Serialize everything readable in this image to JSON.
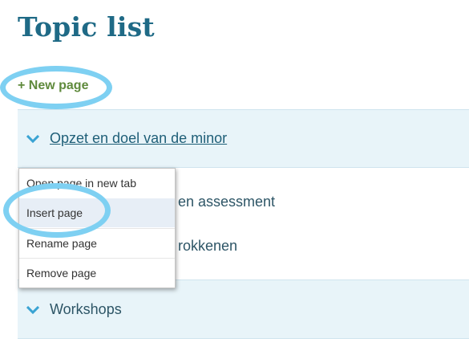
{
  "page": {
    "title": "Topic list"
  },
  "actions": {
    "new_page": "+ New page"
  },
  "topics": [
    {
      "label": "Opzet en doel van de minor"
    },
    {
      "label_partial_1": "en assessment",
      "label_partial_2": "rokkenen"
    },
    {
      "label": "Workshops"
    }
  ],
  "context_menu": {
    "items": [
      {
        "label": "Open page in new tab"
      },
      {
        "label": "Insert page"
      },
      {
        "label": "Rename page"
      },
      {
        "label": "Remove page"
      }
    ]
  },
  "colors": {
    "title": "#1f6a86",
    "new_page": "#5f8a3c",
    "chevron": "#3aa3d3",
    "highlight_ring": "#7ed0f2",
    "row_bg": "#e8f4f9"
  }
}
